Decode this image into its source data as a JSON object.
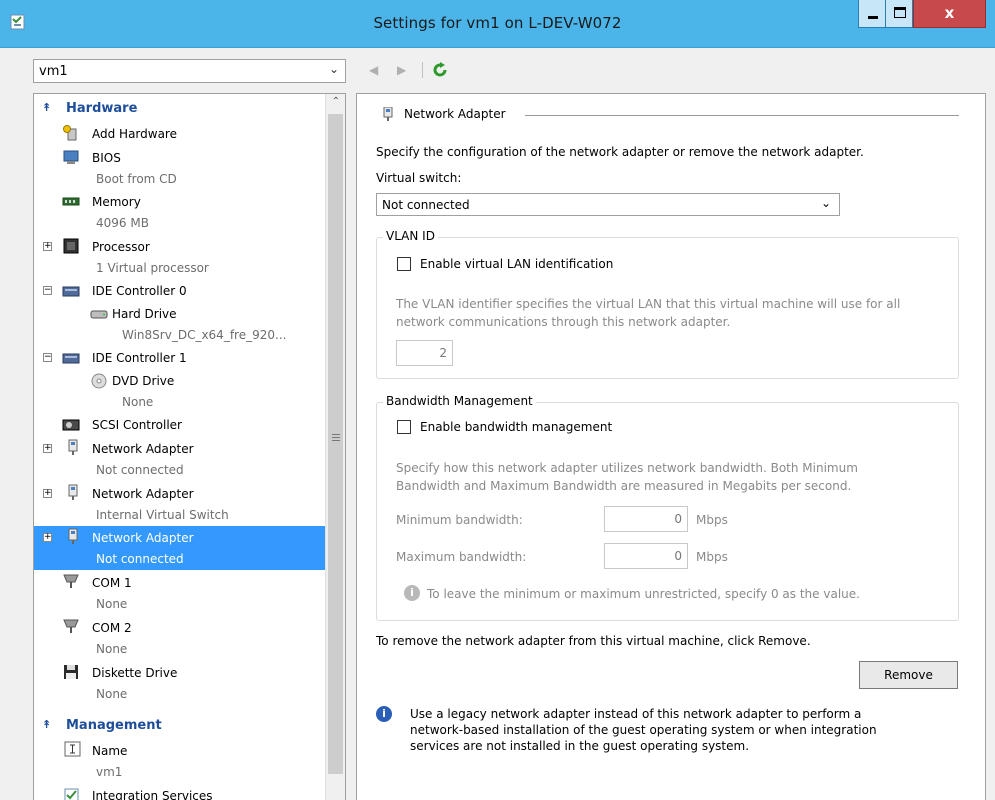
{
  "window": {
    "title": "Settings for vm1 on L-DEV-W072",
    "close_label": "x"
  },
  "vm_selector": {
    "value": "vm1"
  },
  "tree": {
    "hardware_header": "Hardware",
    "management_header": "Management",
    "items": [
      {
        "label": "Add Hardware",
        "detail": ""
      },
      {
        "label": "BIOS",
        "detail": "Boot from CD"
      },
      {
        "label": "Memory",
        "detail": "4096 MB"
      },
      {
        "label": "Processor",
        "detail": "1 Virtual processor"
      },
      {
        "label": "IDE Controller 0",
        "detail": ""
      },
      {
        "label": "Hard Drive",
        "detail": "Win8Srv_DC_x64_fre_920..."
      },
      {
        "label": "IDE Controller 1",
        "detail": ""
      },
      {
        "label": "DVD Drive",
        "detail": "None"
      },
      {
        "label": "SCSI Controller",
        "detail": ""
      },
      {
        "label": "Network Adapter",
        "detail": "Not connected"
      },
      {
        "label": "Network Adapter",
        "detail": "Internal Virtual Switch"
      },
      {
        "label": "Network Adapter",
        "detail": "Not connected"
      },
      {
        "label": "COM 1",
        "detail": "None"
      },
      {
        "label": "COM 2",
        "detail": "None"
      },
      {
        "label": "Diskette Drive",
        "detail": "None"
      },
      {
        "label": "Name",
        "detail": "vm1"
      },
      {
        "label": "Integration Services",
        "detail": ""
      }
    ],
    "selected_index": 11
  },
  "panel": {
    "header": "Network Adapter",
    "intro": "Specify the configuration of the network adapter or remove the network adapter.",
    "virtual_switch_label": "Virtual switch:",
    "virtual_switch_value": "Not connected",
    "vlan": {
      "legend": "VLAN ID",
      "checkbox_label": "Enable virtual LAN identification",
      "desc_line1": "The VLAN identifier specifies the virtual LAN that this virtual machine will use for all",
      "desc_line2": "network communications through this network adapter.",
      "id_value": "2"
    },
    "bandwidth": {
      "legend": "Bandwidth Management",
      "checkbox_label": "Enable bandwidth management",
      "desc_line1": "Specify how this network adapter utilizes network bandwidth. Both Minimum",
      "desc_line2": "Bandwidth and Maximum Bandwidth are measured in Megabits per second.",
      "min_label": "Minimum bandwidth:",
      "min_value": "0",
      "max_label": "Maximum bandwidth:",
      "max_value": "0",
      "unit": "Mbps",
      "hint": "To leave the minimum or maximum unrestricted, specify 0 as the value."
    },
    "remove_text": "To remove the network adapter from this virtual machine, click Remove.",
    "remove_button": "Remove",
    "legacy_line1": "Use a legacy network adapter instead of this network adapter to perform a",
    "legacy_line2": "network-based installation of the guest operating system or when integration",
    "legacy_line3": "services are not installed in the guest operating system."
  }
}
